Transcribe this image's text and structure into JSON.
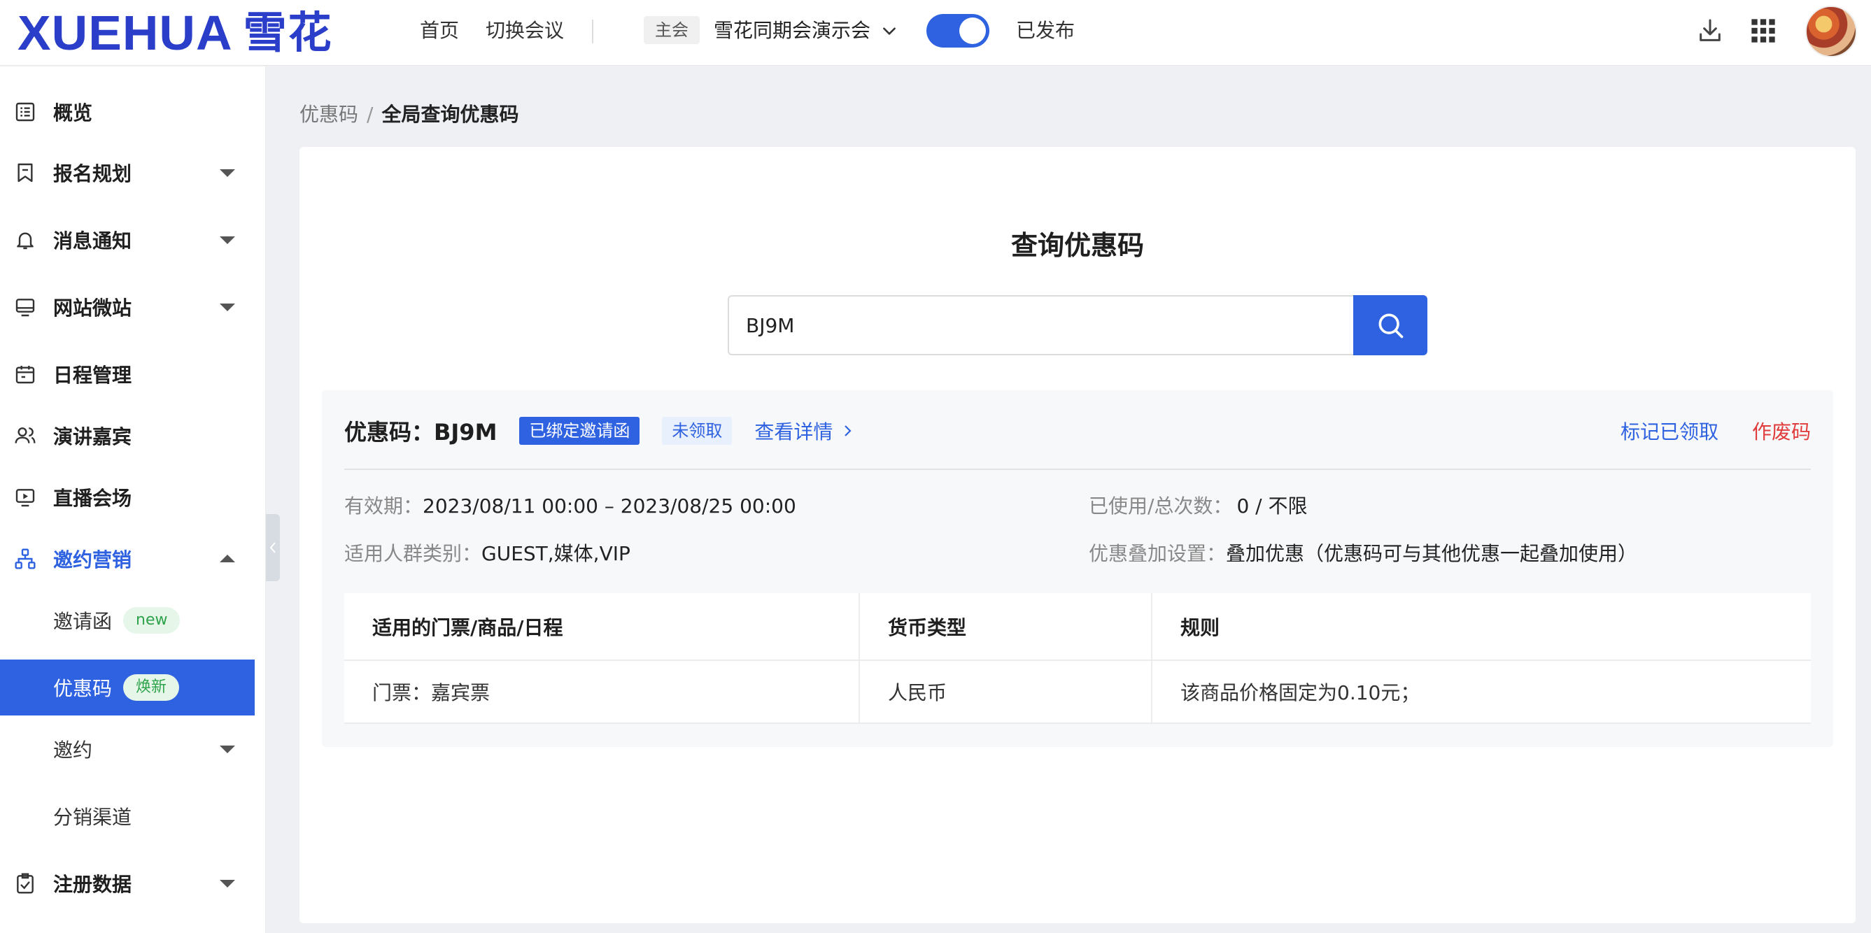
{
  "header": {
    "logo_latin": "XUEHUA",
    "logo_cjk": "雪花",
    "nav_home": "首页",
    "nav_switch": "切换会议",
    "main_tag": "主会",
    "conference_name": "雪花同期会演示会",
    "publish_toggle_on": true,
    "publish_status": "已发布",
    "accent_color": "#2f62e0"
  },
  "sidebar": {
    "items": [
      {
        "label": "概览",
        "icon": "overview-icon"
      },
      {
        "label": "报名规划",
        "icon": "bookmark-icon"
      },
      {
        "label": "消息通知",
        "icon": "bell-icon"
      },
      {
        "label": "网站微站",
        "icon": "monitor-icon"
      },
      {
        "label": "日程管理",
        "icon": "calendar-icon"
      },
      {
        "label": "演讲嘉宾",
        "icon": "users-icon"
      },
      {
        "label": "直播会场",
        "icon": "play-icon"
      },
      {
        "label": "邀约营销",
        "icon": "network-icon"
      },
      {
        "label": "注册数据",
        "icon": "clipboard-check-icon"
      }
    ],
    "sub_items": [
      {
        "label": "邀请函",
        "badge": "new"
      },
      {
        "label": "优惠码",
        "badge": "焕新"
      },
      {
        "label": "邀约"
      },
      {
        "label": "分销渠道"
      }
    ]
  },
  "breadcrumb": {
    "parent": "优惠码",
    "separator": "/",
    "current": "全局查询优惠码"
  },
  "query": {
    "title": "查询优惠码",
    "search_value": "BJ9M"
  },
  "result": {
    "title": "优惠码：BJ9M",
    "tag_bound": "已绑定邀请函",
    "tag_status": "未领取",
    "view_detail": "查看详情",
    "mark_claimed": "标记已领取",
    "void_code": "作废码",
    "validity_label": "有效期：",
    "validity_value": "2023/08/11 00:00 – 2023/08/25 00:00",
    "usage_label": "已使用/总次数：",
    "usage_value": "0 / 不限",
    "audience_label": "适用人群类别：",
    "audience_value": "GUEST,媒体,VIP",
    "stack_label": "优惠叠加设置：",
    "stack_value": "叠加优惠（优惠码可与其他优惠一起叠加使用）",
    "table": {
      "headers": [
        "适用的门票/商品/日程",
        "货币类型",
        "规则"
      ],
      "rows": [
        [
          "门票：嘉宾票",
          "人民币",
          "该商品价格固定为0.10元；"
        ]
      ]
    }
  }
}
